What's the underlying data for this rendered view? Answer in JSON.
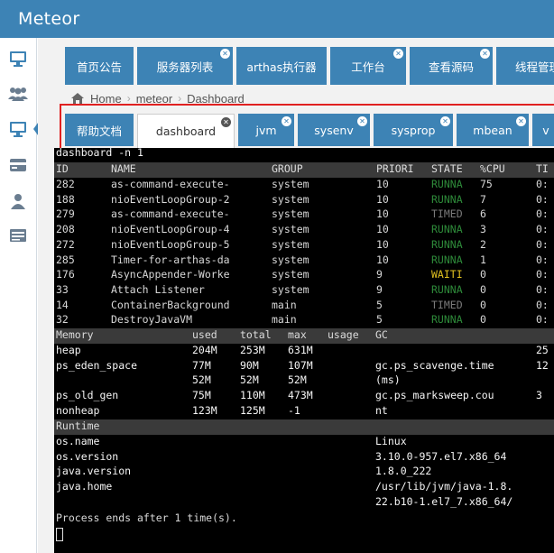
{
  "app": {
    "title": "Meteor"
  },
  "sidebar": {
    "icons": [
      "monitor-icon",
      "users-icon",
      "monitor-icon",
      "card-icon",
      "user-icon",
      "list-icon"
    ]
  },
  "tabs_top": [
    {
      "label": "首页公告",
      "closable": false
    },
    {
      "label": "服务器列表",
      "closable": true
    },
    {
      "label": "arthas执行器",
      "closable": false
    },
    {
      "label": "工作台",
      "closable": true
    },
    {
      "label": "查看源码",
      "closable": true
    },
    {
      "label": "线程管理",
      "closable": true
    }
  ],
  "breadcrumb": {
    "home": "Home",
    "items": [
      "meteor",
      "Dashboard"
    ]
  },
  "tabs_sub": [
    {
      "label": "帮助文档",
      "active": false
    },
    {
      "label": "dashboard",
      "active": true
    },
    {
      "label": "jvm",
      "active": false
    },
    {
      "label": "sysenv",
      "active": false
    },
    {
      "label": "sysprop",
      "active": false
    },
    {
      "label": "mbean",
      "active": false
    },
    {
      "label": "v",
      "active": false
    }
  ],
  "terminal": {
    "command": "dashboard -n 1",
    "thread_header": [
      "ID",
      "NAME",
      "GROUP",
      "PRIORI",
      "STATE",
      "%CPU",
      "TI"
    ],
    "threads": [
      [
        "282",
        "as-command-execute-",
        "system",
        "10",
        "RUNNA",
        "75",
        "0:"
      ],
      [
        "188",
        "nioEventLoopGroup-2",
        "system",
        "10",
        "RUNNA",
        "7",
        "0:"
      ],
      [
        "279",
        "as-command-execute-",
        "system",
        "10",
        "TIMED",
        "6",
        "0:"
      ],
      [
        "208",
        "nioEventLoopGroup-4",
        "system",
        "10",
        "RUNNA",
        "3",
        "0:"
      ],
      [
        "272",
        "nioEventLoopGroup-5",
        "system",
        "10",
        "RUNNA",
        "2",
        "0:"
      ],
      [
        "285",
        "Timer-for-arthas-da",
        "system",
        "10",
        "RUNNA",
        "1",
        "0:"
      ],
      [
        "176",
        "AsyncAppender-Worke",
        "system",
        "9",
        "WAITI",
        "0",
        "0:"
      ],
      [
        "33",
        "Attach Listener",
        "system",
        "9",
        "RUNNA",
        "0",
        "0:"
      ],
      [
        "14",
        "ContainerBackground",
        "main",
        "5",
        "TIMED",
        "0",
        "0:"
      ],
      [
        "32",
        "DestroyJavaVM",
        "main",
        "5",
        "RUNNA",
        "0",
        "0:"
      ]
    ],
    "memory_header": [
      "Memory",
      "used",
      "total",
      "max",
      "usage",
      "GC"
    ],
    "memory": [
      [
        "heap",
        "204M",
        "253M",
        "631M",
        "",
        "",
        "25"
      ],
      [
        "ps_eden_space",
        "77M",
        "90M",
        "107M",
        "",
        "gc.ps_scavenge.time",
        "12"
      ],
      [
        "",
        "52M",
        "52M",
        "52M",
        "",
        "(ms)",
        ""
      ],
      [
        "ps_old_gen",
        "75M",
        "110M",
        "473M",
        "",
        "gc.ps_marksweep.cou",
        "3"
      ],
      [
        "nonheap",
        "123M",
        "125M",
        "-1",
        "",
        "nt",
        ""
      ]
    ],
    "runtime_header": "Runtime",
    "runtime": [
      [
        "os.name",
        "Linux"
      ],
      [
        "os.version",
        "3.10.0-957.el7.x86_64"
      ],
      [
        "java.version",
        "1.8.0_222"
      ],
      [
        "java.home",
        "/usr/lib/jvm/java-1.8."
      ],
      [
        "",
        "22.b10-1.el7_7.x86_64/"
      ]
    ],
    "footer": "Process ends after 1 time(s).",
    "state_colors": {
      "RUNNA": "#2e8b3a",
      "TIMED": "#7a7a7a",
      "WAITI": "#e0c020"
    }
  }
}
